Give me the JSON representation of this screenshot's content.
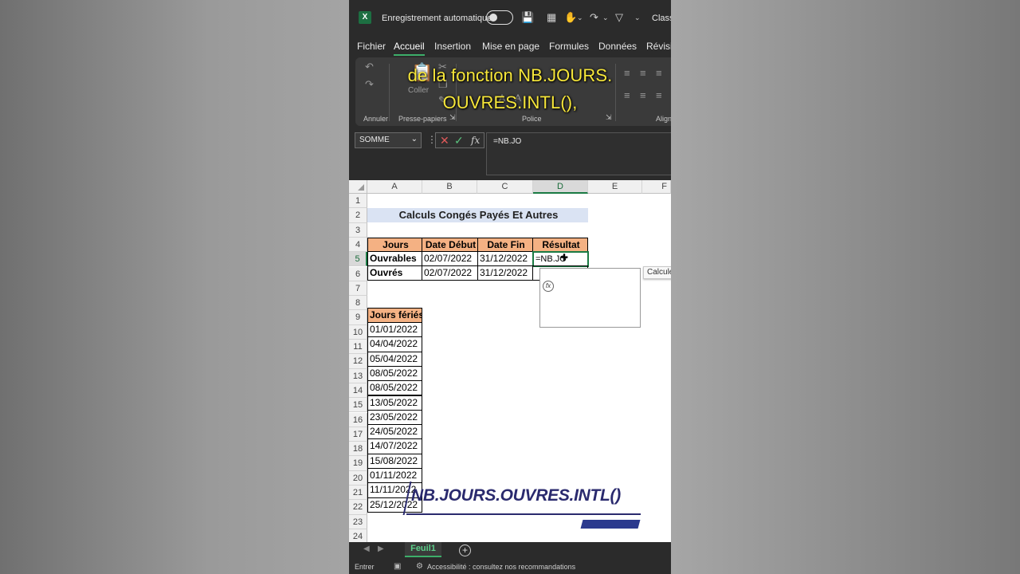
{
  "titlebar": {
    "app_icon": "excel-icon",
    "autosave_label": "Enregistrement automatique",
    "classe_label": "Classe"
  },
  "menu": {
    "tabs": [
      "Fichier",
      "Accueil",
      "Insertion",
      "Mise en page",
      "Formules",
      "Données",
      "Révisio"
    ],
    "active": "Accueil"
  },
  "ribbon": {
    "groups": [
      "Annuler",
      "Presse-papiers",
      "Police",
      "Align"
    ],
    "coller_label": "Coller"
  },
  "subtitle": {
    "line1": "de la fonction NB.JOURS.",
    "line2": "OUVRES.INTL(),"
  },
  "formula_bar": {
    "name_box": "SOMME",
    "fx_label": "fx",
    "formula": "=NB.JO"
  },
  "grid": {
    "columns": [
      "A",
      "B",
      "C",
      "D",
      "E",
      "F"
    ],
    "selected_column": "D",
    "selected_row": 5,
    "rows": [
      "1",
      "2",
      "3",
      "4",
      "5",
      "6",
      "7",
      "8",
      "9",
      "10",
      "11",
      "12",
      "13",
      "14",
      "15",
      "16",
      "17",
      "18",
      "19",
      "20",
      "21",
      "22",
      "23",
      "24"
    ],
    "title": "Calculs Congés Payés Et Autres",
    "table_headers": [
      "Jours",
      "Date Début",
      "Date Fin",
      "Résultat"
    ],
    "table_rows": [
      {
        "jours": "Ouvrables",
        "debut": "02/07/2022",
        "fin": "31/12/2022",
        "resultat": "=NB.JO"
      },
      {
        "jours": "Ouvrés",
        "debut": "02/07/2022",
        "fin": "31/12/2022",
        "resultat": ""
      }
    ],
    "holidays_header": "Jours fériés",
    "holidays": [
      "01/01/2022",
      "04/04/2022",
      "05/04/2022",
      "08/05/2022",
      "08/05/2022",
      "13/05/2022",
      "23/05/2022",
      "24/05/2022",
      "14/07/2022",
      "15/08/2022",
      "01/11/2022",
      "11/11/2022",
      "25/12/2022"
    ]
  },
  "autocomplete_tooltip": "Calcule",
  "overlay_title": "NB.JOURS.OUVRES.INTL()",
  "sheet_tab": "Feuil1",
  "status": {
    "mode": "Entrer",
    "accessibility": "Accessibilité : consultez nos recommandations"
  }
}
